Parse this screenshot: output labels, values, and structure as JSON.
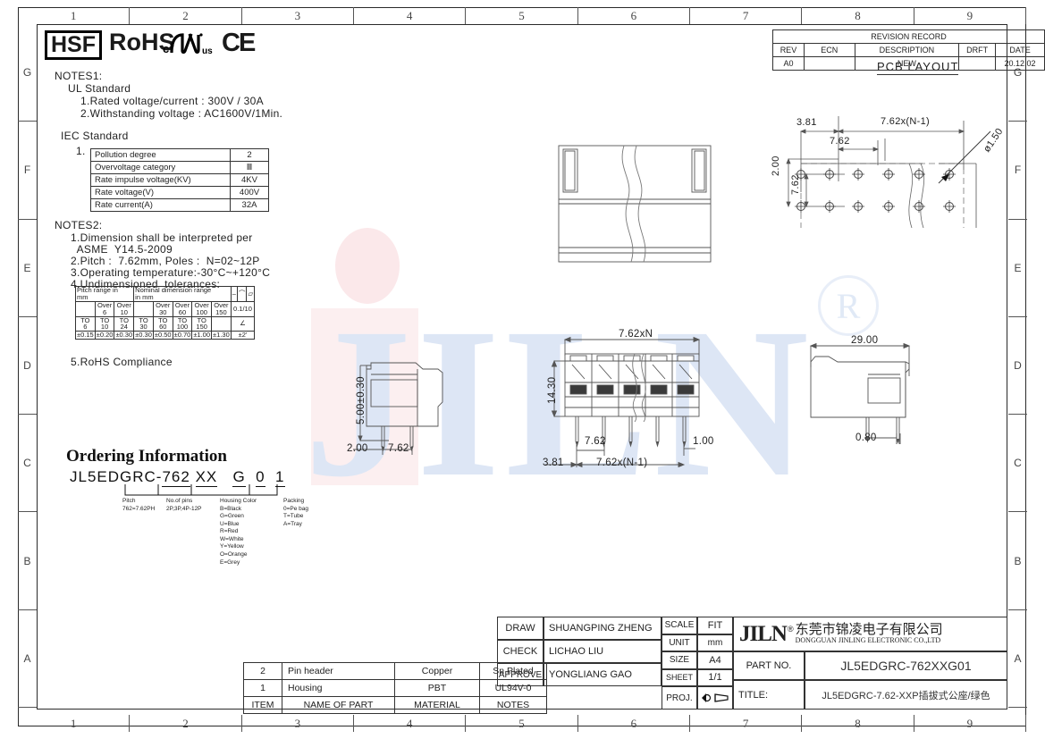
{
  "sheet": {
    "zones_top": [
      "1",
      "2",
      "3",
      "4",
      "5",
      "6",
      "7",
      "8",
      "9"
    ],
    "zones_bottom": [
      "1",
      "2",
      "3",
      "4",
      "5",
      "6",
      "7",
      "8",
      "9"
    ],
    "zones_left": [
      "G",
      "F",
      "E",
      "D",
      "C",
      "B",
      "A"
    ],
    "zones_right": [
      "G",
      "F",
      "E",
      "D",
      "C",
      "B",
      "A"
    ],
    "watermark_text": "JILN",
    "watermark_mark": "R"
  },
  "compliance": {
    "hsf": "HSF",
    "rohs": "RoHS",
    "ul_c": "c",
    "ul_us": "us",
    "ce": "CE"
  },
  "notes1": {
    "heading": "NOTES1:",
    "ul_standard": "UL Standard",
    "lines": [
      "1.Rated voltage/current : 300V / 30A",
      "2.Withstanding voltage : AC1600V/1Min."
    ],
    "iec_standard": "IEC Standard",
    "iec_index": "1.",
    "iec_table": [
      {
        "label": "Pollution degree",
        "value": "2"
      },
      {
        "label": "Overvoltage category",
        "value": "Ⅲ"
      },
      {
        "label": "Rate impulse voltage(KV)",
        "value": "4KV"
      },
      {
        "label": "Rate voltage(V)",
        "value": "400V"
      },
      {
        "label": "Rate current(A)",
        "value": "32A"
      }
    ]
  },
  "notes2": {
    "heading": "NOTES2:",
    "lines": [
      "1.Dimension shall be interpreted per",
      "  ASME  Y14.5-2009",
      "2.Pitch :  7.62mm, Poles :  N=02~12P",
      "3.Operating temperature:-30°C~+120°C",
      "4.Undimensioned  tolerances:"
    ],
    "last_line": "5.RoHS Compliance",
    "tolerance_table": {
      "header_left": "Pitch range in\nmm",
      "header_mid": "Nominal dimension range\nin mm",
      "sym_dash": "–",
      "sym_arc": "⌒",
      "sym_par": "▱",
      "row_over": [
        "",
        "Over\n6",
        "Over\n10",
        "",
        "Over\n30",
        "Over\n60",
        "Over\n100",
        "Over\n150"
      ],
      "row_to": [
        "TO\n6",
        "TO\n10",
        "TO\n24",
        "TO\n30",
        "TO\n60",
        "TO\n100",
        "TO\n150",
        ""
      ],
      "row_tol": [
        "±0.15",
        "±0.20",
        "±0.30",
        "±0.30",
        "±0.50",
        "±0.70",
        "±1.00",
        "±1.30"
      ],
      "right_top": "0.1/10",
      "right_mid": "∠",
      "right_bot": "±2'"
    }
  },
  "ordering": {
    "title": "Ordering Information",
    "prefix": "JL5EDGRC-",
    "field_pitch": "762",
    "field_pins": "XX",
    "field_color": "G",
    "field_pack0": "0",
    "field_pack1": "1",
    "legend_pitch": "Pitch\n762=7.62PH",
    "legend_pins": "No.of pins\n2P,3P,4P-12P",
    "legend_color": "Housing Color\nB=Black\nG=Green\nU=Blue\nR=Red\nW=White\nY=Yellow\nO=Orange\nE=Grey",
    "legend_pack": "Packing\n0=Pe bag\nT=Tube\nA=Tray"
  },
  "revision": {
    "title": "REVISION RECORD",
    "headers": [
      "REV",
      "ECN",
      "DESCRIPTION",
      "DRFT",
      "DATE"
    ],
    "rows": [
      [
        "A0",
        "",
        "NEW",
        "",
        "20.12.02"
      ]
    ]
  },
  "pcb_layout": {
    "title": "PCB LAYOUT",
    "dim_3_81": "3.81",
    "dim_7_62_n1": "7.62x(N-1)",
    "dim_7_62": "7.62",
    "dim_2_00": "2.00",
    "dim_7_62_v": "7.62",
    "dim_hole": "ø1.50"
  },
  "views": {
    "side_left": {
      "dim_height": "5.00±0.30",
      "dim_2_00": "2.00",
      "dim_7_62": "7.62"
    },
    "front": {
      "dim_width": "7.62xN",
      "dim_height": "14.30",
      "dim_pitch": "7.62",
      "dim_span": "7.62x(N-1)",
      "dim_first": "3.81",
      "dim_pin": "1.00"
    },
    "side_right": {
      "dim_length": "29.00",
      "dim_pin": "0.80"
    }
  },
  "parts_list": {
    "rows": [
      {
        "item": "2",
        "name": "Pin header",
        "material": "Copper",
        "notes": "Sn Plated"
      },
      {
        "item": "1",
        "name": "Housing",
        "material": "PBT",
        "notes": "UL94V-0"
      }
    ],
    "headers": {
      "item": "ITEM",
      "name": "NAME OF PART",
      "material": "MATERIAL",
      "notes": "NOTES"
    }
  },
  "title_block": {
    "draw_label": "DRAW",
    "draw_value": "SHUANGPING  ZHENG",
    "check_label": "CHECK",
    "check_value": "LICHAO    LIU",
    "approve_label": "APPROVE",
    "approve_value": "YONGLIANG  GAO",
    "scale_label": "SCALE",
    "scale_value": "FIT",
    "unit_label": "UNIT",
    "unit_value": "mm",
    "size_label": "SIZE",
    "size_value": "A4",
    "sheet_label": "SHEET",
    "sheet_value": "1/1",
    "proj_label": "PROJ.",
    "company_logo": "JILN",
    "company_reg": "®",
    "company_cn": "东莞市锦凌电子有限公司",
    "company_en": "DONGGUAN JINLING ELECTRONIC CO.,LTD",
    "partno_label": "PART NO.",
    "partno_value": "JL5EDGRC-762XXG01",
    "title_label": "TITLE:",
    "title_value": "JL5EDGRC-7.62-XXP插拔式公座/绿色"
  }
}
